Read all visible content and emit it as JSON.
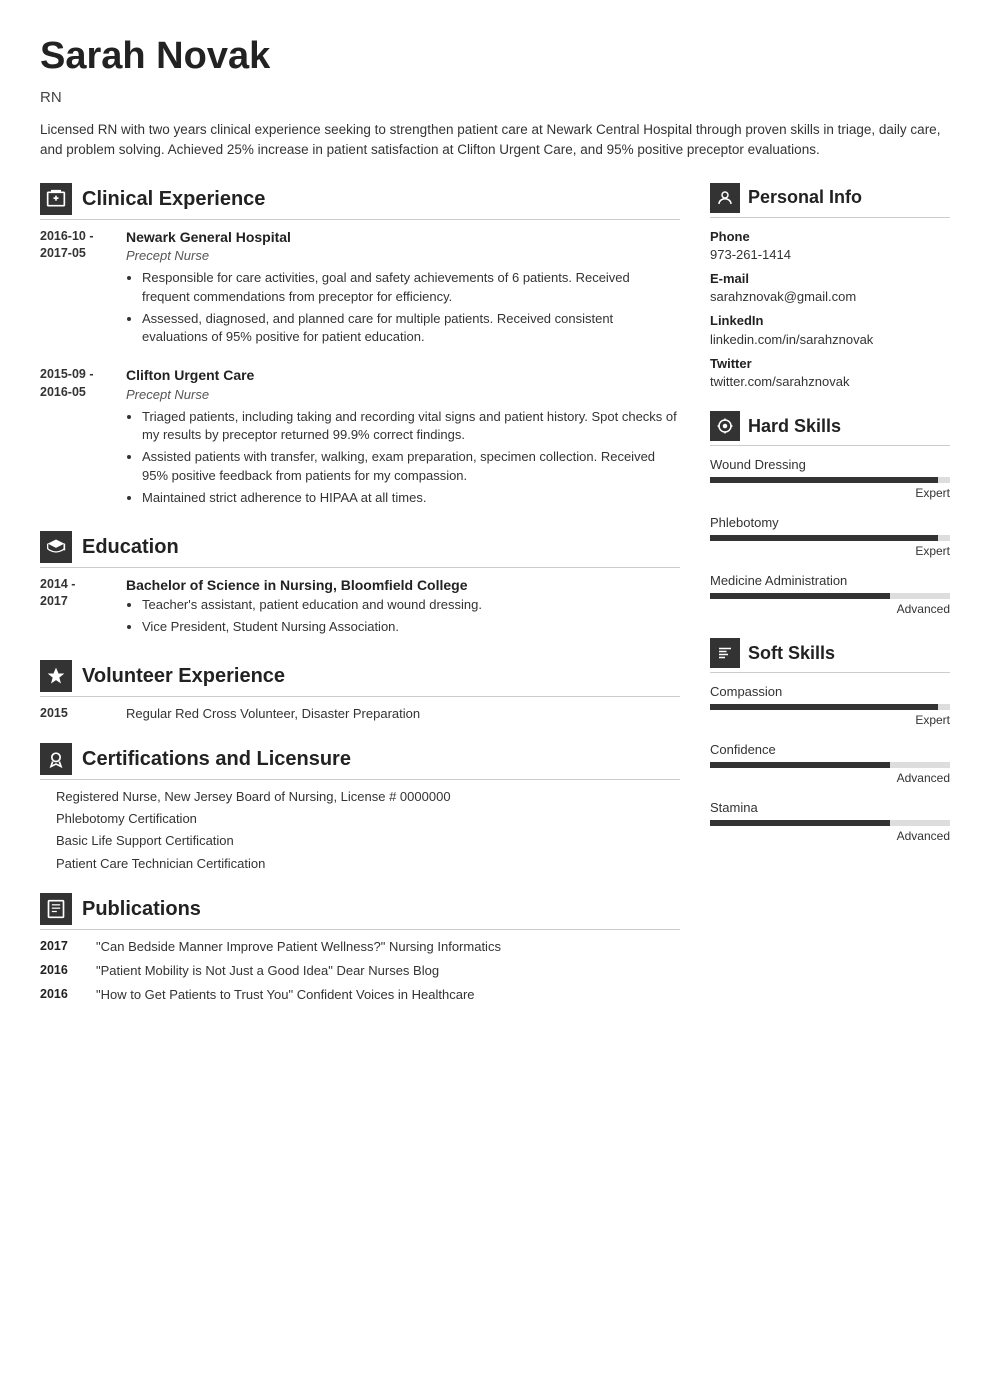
{
  "header": {
    "name": "Sarah Novak",
    "title": "RN",
    "summary": "Licensed RN with two years clinical experience seeking to strengthen patient care at Newark Central Hospital through proven skills in triage, daily care, and problem solving. Achieved 25% increase in patient satisfaction at Clifton Urgent Care, and 95% positive preceptor evaluations."
  },
  "sections": {
    "clinical_experience": {
      "label": "Clinical Experience",
      "entries": [
        {
          "date": "2016-10 -\n2017-05",
          "org": "Newark General Hospital",
          "role": "Precept Nurse",
          "bullets": [
            "Responsible for care activities, goal and safety achievements of 6 patients. Received frequent commendations from preceptor for efficiency.",
            "Assessed, diagnosed, and planned care for multiple patients. Received consistent evaluations of 95% positive for patient education."
          ]
        },
        {
          "date": "2015-09 -\n2016-05",
          "org": "Clifton Urgent Care",
          "role": "Precept Nurse",
          "bullets": [
            "Triaged patients, including taking and recording vital signs and patient history. Spot checks of my results by preceptor returned 99.9% correct findings.",
            "Assisted patients with transfer, walking, exam preparation, specimen collection. Received 95% positive feedback from patients for my compassion.",
            "Maintained strict adherence to HIPAA at all times."
          ]
        }
      ]
    },
    "education": {
      "label": "Education",
      "entries": [
        {
          "date": "2014 -\n2017",
          "org": "Bachelor of Science in Nursing, Bloomfield College",
          "role": "",
          "bullets": [
            "Teacher's assistant, patient education and wound dressing.",
            "Vice President, Student Nursing Association."
          ]
        }
      ]
    },
    "volunteer": {
      "label": "Volunteer Experience",
      "entries": [
        {
          "date": "2015",
          "text": "Regular Red Cross Volunteer, Disaster Preparation"
        }
      ]
    },
    "certifications": {
      "label": "Certifications and Licensure",
      "items": [
        "Registered Nurse, New Jersey Board of Nursing, License # 0000000",
        "Phlebotomy Certification",
        "Basic Life Support Certification",
        "Patient Care Technician Certification"
      ]
    },
    "publications": {
      "label": "Publications",
      "entries": [
        {
          "date": "2017",
          "text": "\"Can Bedside Manner Improve Patient Wellness?\" Nursing Informatics"
        },
        {
          "date": "2016",
          "text": "\"Patient Mobility is Not Just a Good Idea\" Dear Nurses Blog"
        },
        {
          "date": "2016",
          "text": "\"How to Get Patients to Trust You\" Confident Voices in Healthcare"
        }
      ]
    }
  },
  "right": {
    "personal_info": {
      "label": "Personal Info",
      "fields": [
        {
          "label": "Phone",
          "value": "973-261-1414"
        },
        {
          "label": "E-mail",
          "value": "sarahznovak@gmail.com"
        },
        {
          "label": "LinkedIn",
          "value": "linkedin.com/in/sarahznovak"
        },
        {
          "label": "Twitter",
          "value": "twitter.com/sarahznovak"
        }
      ]
    },
    "hard_skills": {
      "label": "Hard Skills",
      "items": [
        {
          "name": "Wound Dressing",
          "level": "Expert",
          "pct": 95
        },
        {
          "name": "Phlebotomy",
          "level": "Expert",
          "pct": 95
        },
        {
          "name": "Medicine Administration",
          "level": "Advanced",
          "pct": 75
        }
      ]
    },
    "soft_skills": {
      "label": "Soft Skills",
      "items": [
        {
          "name": "Compassion",
          "level": "Expert",
          "pct": 95
        },
        {
          "name": "Confidence",
          "level": "Advanced",
          "pct": 75
        },
        {
          "name": "Stamina",
          "level": "Advanced",
          "pct": 75
        }
      ]
    }
  }
}
